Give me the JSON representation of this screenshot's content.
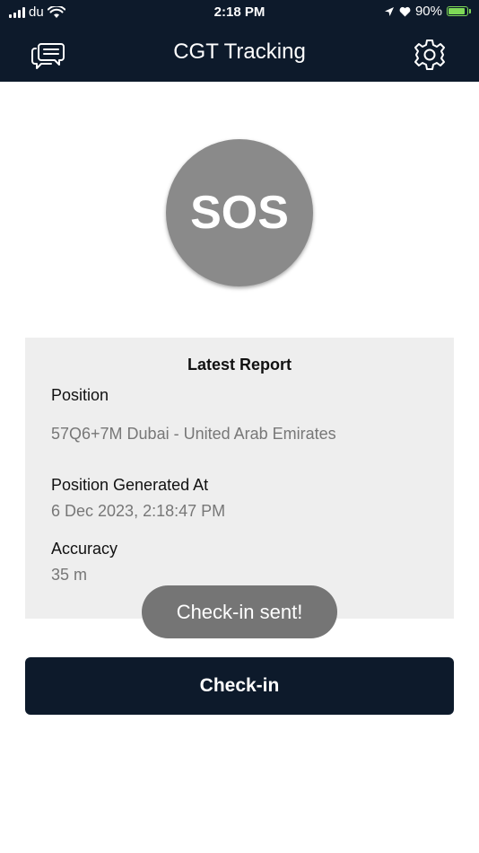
{
  "status_bar": {
    "carrier": "du",
    "time": "2:18 PM",
    "battery": "90%"
  },
  "header": {
    "title": "CGT Tracking",
    "left_icon": "chat-icon",
    "right_icon": "gear-icon"
  },
  "sos": {
    "label": "SOS"
  },
  "report": {
    "title": "Latest Report",
    "position_label": "Position",
    "position_value": "57Q6+7M Dubai - United Arab Emirates",
    "generated_label": "Position Generated At",
    "generated_value": "6 Dec 2023, 2:18:47 PM",
    "accuracy_label": "Accuracy",
    "accuracy_value": "35 m"
  },
  "toast": {
    "message": "Check-in sent!"
  },
  "checkin": {
    "label": "Check-in"
  },
  "colors": {
    "header_bg": "#0d1a2b",
    "sos_bg": "#8a8a8a",
    "card_bg": "#eeeeee",
    "toast_bg": "#757575",
    "battery": "#7ed957"
  }
}
